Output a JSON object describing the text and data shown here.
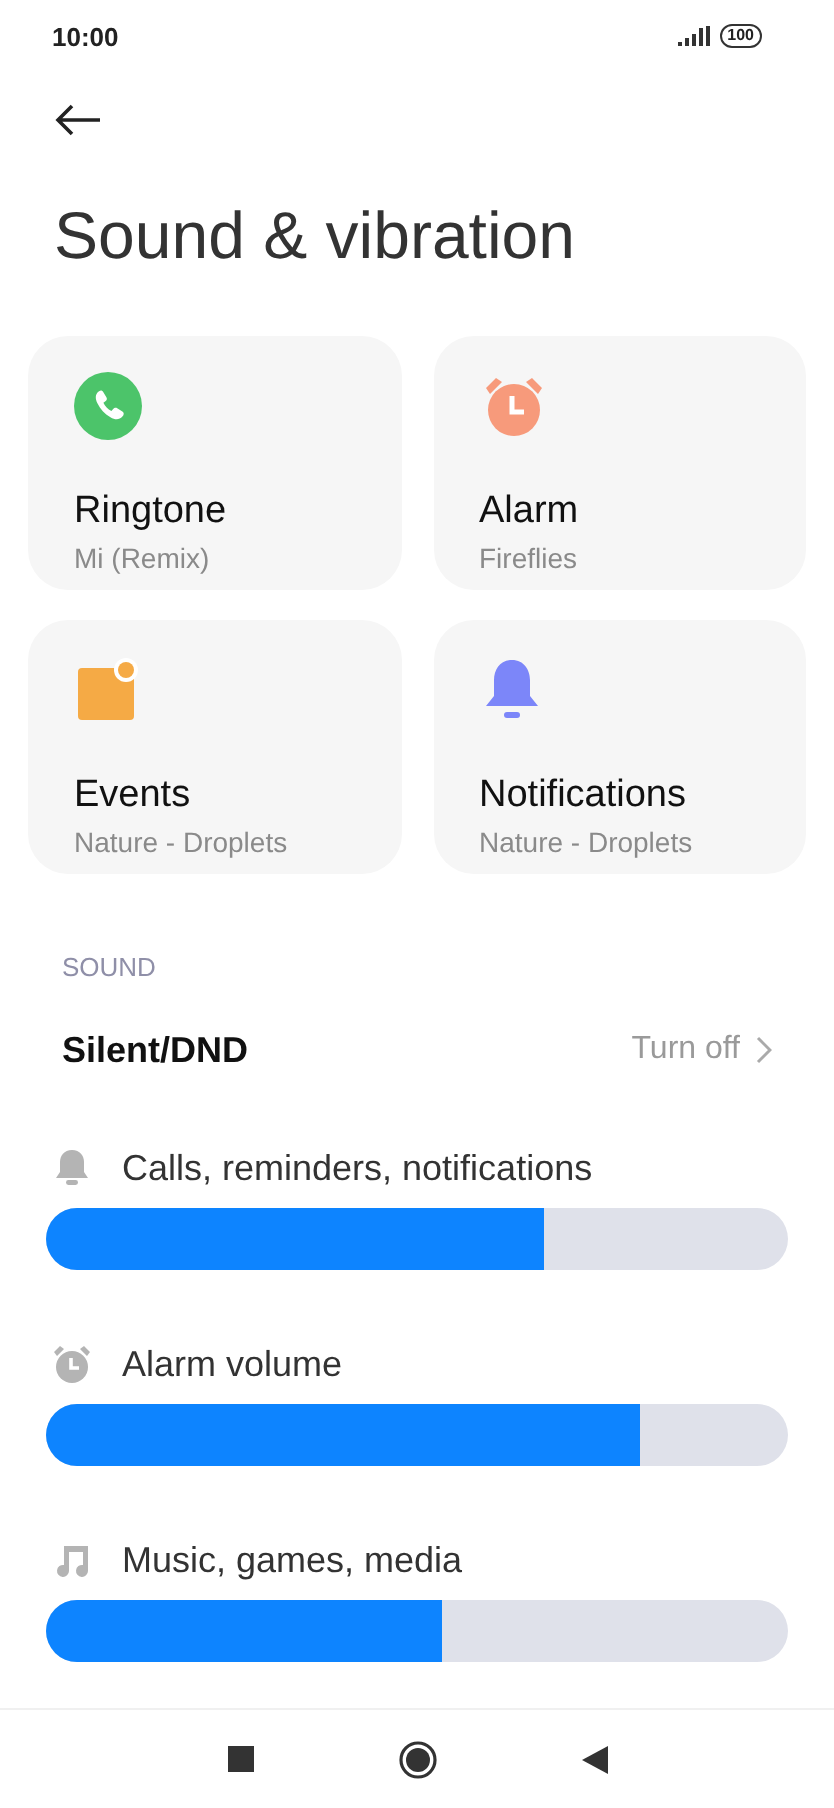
{
  "status_bar": {
    "time": "10:00",
    "battery": "100"
  },
  "title": "Sound & vibration",
  "cards": [
    {
      "kind": "ringtone",
      "title": "Ringtone",
      "subtitle": "Mi (Remix)"
    },
    {
      "kind": "alarm",
      "title": "Alarm",
      "subtitle": "Fireflies"
    },
    {
      "kind": "events",
      "title": "Events",
      "subtitle": "Nature - Droplets"
    },
    {
      "kind": "notifications",
      "title": "Notifications",
      "subtitle": "Nature - Droplets"
    }
  ],
  "section": "SOUND",
  "silent_dnd": {
    "label": "Silent/DND",
    "value": "Turn off"
  },
  "sliders": [
    {
      "kind": "calls",
      "label": "Calls, reminders, notifications",
      "level": 0.67
    },
    {
      "kind": "alarm",
      "label": "Alarm volume",
      "level": 0.8
    },
    {
      "kind": "media",
      "label": "Music, games, media",
      "level": 0.535
    }
  ]
}
